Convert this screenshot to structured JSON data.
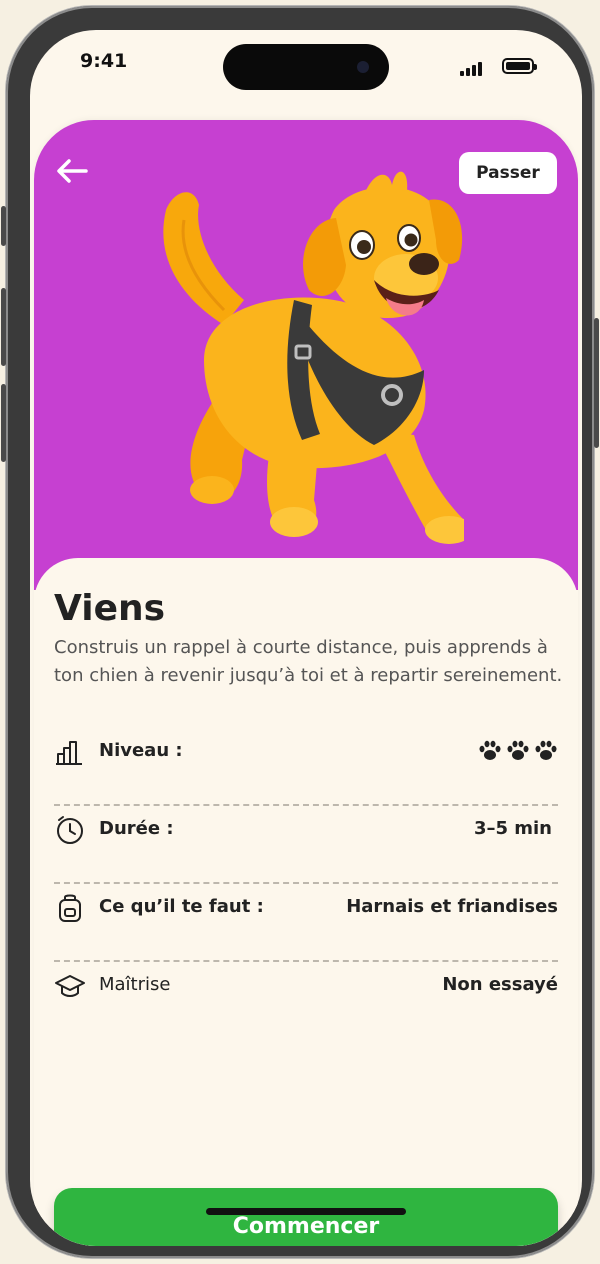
{
  "status_bar": {
    "time": "9:41"
  },
  "header": {
    "skip_label": "Passer"
  },
  "activity": {
    "title": "Viens",
    "description": "Construis un rappel à courte distance, puis apprends à ton chien à revenir jusqu’à toi et à repartir sereinement."
  },
  "details": {
    "level": {
      "label": "Niveau :",
      "value": 3,
      "max": 3
    },
    "duration": {
      "label": "Durée :",
      "value": "3–5 min"
    },
    "needs": {
      "label": "Ce qu’il te faut :",
      "value": "Harnais et friandises"
    },
    "mastery": {
      "label": "Maîtrise",
      "value": "Non essayé"
    }
  },
  "cta": {
    "start_label": "Commencer"
  },
  "colors": {
    "hero_bg": "#c640d1",
    "cta_bg": "#2fb540",
    "page_bg": "#fdf7ec"
  }
}
